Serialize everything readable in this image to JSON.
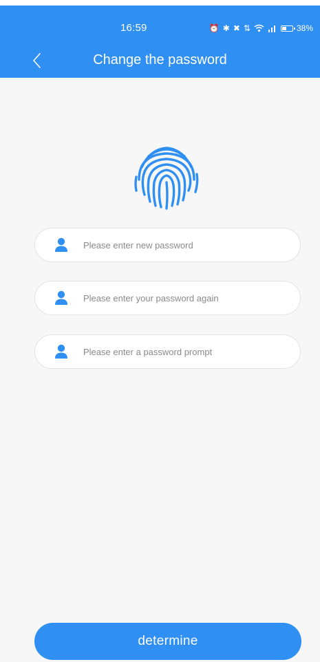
{
  "status_bar": {
    "time": "16:59",
    "battery": "38%",
    "icons": [
      "alarm-icon",
      "bluetooth-icon",
      "mute-icon",
      "data-speed-icon",
      "wifi-icon",
      "signal-icon",
      "battery-icon"
    ]
  },
  "header": {
    "title": "Change the password",
    "back_icon": "chevron-left-icon"
  },
  "fingerprint_icon": "fingerprint-icon",
  "form": {
    "new_password": {
      "placeholder": "Please enter new password",
      "value": ""
    },
    "confirm_password": {
      "placeholder": "Please enter your password again",
      "value": ""
    },
    "password_prompt": {
      "placeholder": "Please enter a password prompt",
      "value": ""
    }
  },
  "submit_label": "determine",
  "colors": {
    "accent": "#2f8ff2",
    "background": "#f7f7f7",
    "field_background": "#ffffff"
  }
}
